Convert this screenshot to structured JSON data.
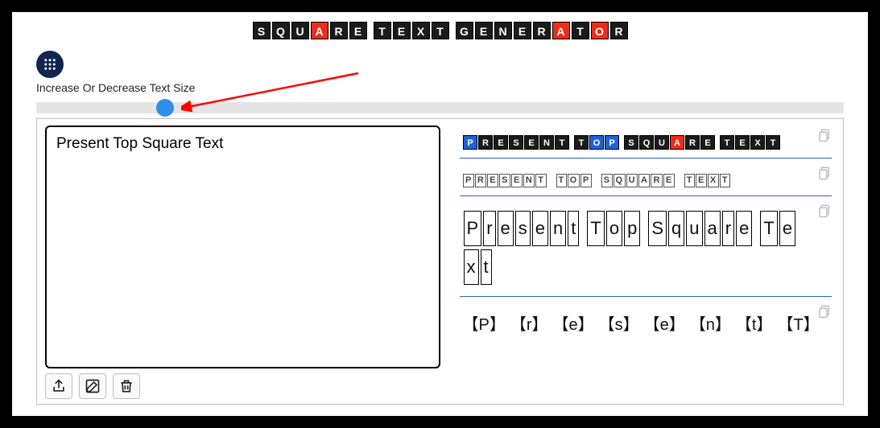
{
  "title_letters": [
    {
      "ch": "S",
      "style": "black"
    },
    {
      "ch": "Q",
      "style": "black"
    },
    {
      "ch": "U",
      "style": "black"
    },
    {
      "ch": "A",
      "style": "red"
    },
    {
      "ch": "R",
      "style": "black"
    },
    {
      "ch": "E",
      "style": "black"
    },
    {
      "ch": " ",
      "style": "gap"
    },
    {
      "ch": "T",
      "style": "black"
    },
    {
      "ch": "E",
      "style": "black"
    },
    {
      "ch": "X",
      "style": "black"
    },
    {
      "ch": "T",
      "style": "black"
    },
    {
      "ch": " ",
      "style": "gap"
    },
    {
      "ch": "G",
      "style": "black"
    },
    {
      "ch": "E",
      "style": "black"
    },
    {
      "ch": "N",
      "style": "black"
    },
    {
      "ch": "E",
      "style": "black"
    },
    {
      "ch": "R",
      "style": "black"
    },
    {
      "ch": "A",
      "style": "red"
    },
    {
      "ch": "T",
      "style": "black"
    },
    {
      "ch": "O",
      "style": "red"
    },
    {
      "ch": "R",
      "style": "black"
    }
  ],
  "slider": {
    "label": "Increase Or Decrease Text Size",
    "percent": 16
  },
  "input": {
    "value": "Present Top Square Text"
  },
  "outputs": {
    "style1_letters": [
      {
        "ch": "P",
        "style": "blue"
      },
      {
        "ch": "R",
        "style": "black"
      },
      {
        "ch": "E",
        "style": "black"
      },
      {
        "ch": "S",
        "style": "black"
      },
      {
        "ch": "E",
        "style": "black"
      },
      {
        "ch": "N",
        "style": "black"
      },
      {
        "ch": "T",
        "style": "black"
      },
      {
        "ch": " ",
        "style": "gap"
      },
      {
        "ch": "T",
        "style": "black"
      },
      {
        "ch": "O",
        "style": "blue"
      },
      {
        "ch": "P",
        "style": "blue"
      },
      {
        "ch": " ",
        "style": "gap"
      },
      {
        "ch": "S",
        "style": "black"
      },
      {
        "ch": "Q",
        "style": "black"
      },
      {
        "ch": "U",
        "style": "black"
      },
      {
        "ch": "A",
        "style": "red"
      },
      {
        "ch": "R",
        "style": "black"
      },
      {
        "ch": "E",
        "style": "black"
      },
      {
        "ch": " ",
        "style": "gap"
      },
      {
        "ch": "T",
        "style": "black"
      },
      {
        "ch": "E",
        "style": "black"
      },
      {
        "ch": "X",
        "style": "black"
      },
      {
        "ch": "T",
        "style": "black"
      }
    ],
    "style2_letters": [
      "P",
      "R",
      "E",
      "S",
      "E",
      "N",
      "T",
      " ",
      "T",
      "O",
      "P",
      " ",
      "S",
      "Q",
      "U",
      "A",
      "R",
      "E",
      " ",
      "T",
      "E",
      "X",
      "T"
    ],
    "style3_letters": [
      "P",
      "r",
      "e",
      "s",
      "e",
      "n",
      "t",
      " ",
      "T",
      "o",
      "p",
      " ",
      "S",
      "q",
      "u",
      "a",
      "r",
      "e",
      " ",
      "T",
      "e",
      "x",
      "t"
    ],
    "style4_letters": [
      "P",
      "r",
      "e",
      "s",
      "e",
      "n",
      "t",
      "T"
    ]
  },
  "icons": {
    "grid": "grid-icon",
    "share": "share-icon",
    "edit": "edit-icon",
    "trash": "trash-icon",
    "copy": "copy-icon"
  }
}
